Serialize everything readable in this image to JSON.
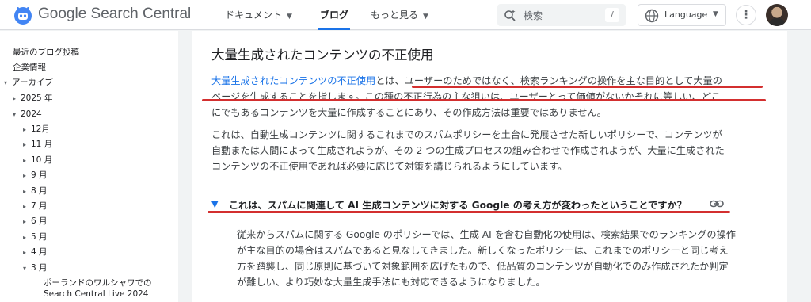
{
  "header": {
    "brand": "Google Search Central",
    "nav": [
      {
        "label": "ドキュメント",
        "has_dropdown": true
      },
      {
        "label": "ブログ",
        "active": true
      },
      {
        "label": "もっと見る",
        "has_dropdown": true
      }
    ],
    "search_placeholder": "検索",
    "search_shortcut": "/",
    "language_label": "Language",
    "more_label": "⋮",
    "accent_color": "#1a73e8"
  },
  "sidebar": {
    "items": [
      {
        "label": "最近のブログ投稿"
      },
      {
        "label": "企業情報"
      },
      {
        "label": "アーカイブ",
        "caret": "▾"
      },
      {
        "label": "2025 年",
        "caret": "▸"
      },
      {
        "label": "2024",
        "caret": "▾"
      },
      {
        "label": "12月",
        "caret": "▸"
      },
      {
        "label": "11 月",
        "caret": "▸"
      },
      {
        "label": "10 月",
        "caret": "▸"
      },
      {
        "label": "9 月",
        "caret": "▸"
      },
      {
        "label": "8 月",
        "caret": "▸"
      },
      {
        "label": "7 月",
        "caret": "▸"
      },
      {
        "label": "6 月",
        "caret": "▸"
      },
      {
        "label": "5 月",
        "caret": "▸"
      },
      {
        "label": "4 月",
        "caret": "▸"
      },
      {
        "label": "3 月",
        "caret": "▾"
      }
    ],
    "post_title_line1": "ポーランドのワルシャワでの",
    "post_title_line2": "Search Central Live 2024"
  },
  "article": {
    "heading": "大量生成されたコンテンツの不正使用",
    "intro_link": "大量生成されたコンテンツの不正使用",
    "intro_line1_rest": "とは、ユーザーのためではなく、検索ランキングの操作を主な目的として大量の",
    "intro_line2": "ページを生成することを指します。この種の不正行為の主な狙いは、ユーザーとって価値がないかそれに等しい、どこ",
    "intro_line3": "にでもあるコンテンツを大量に作成することにあり、その作成方法は重要ではありません。",
    "para2_line1": "これは、自動生成コンテンツに関するこれまでのスパムポリシーを土台に発展させた新しいポリシーで、コンテンツが",
    "para2_line2": "自動または人間によって生成されようが、その 2 つの生成プロセスの組み合わせで作成されようが、大量に生成された",
    "para2_line3": "コンテンツの不正使用であれば必要に応じて対策を講じられるようにしています。",
    "question": "これは、スパムに関連して AI 生成コンテンツに対する Google の考え方が変わったということですか？",
    "answer_line1": "従来からスパムに関する Google のポリシーでは、生成 AI を含む自動化の使用は、検索結果でのランキングの操作",
    "answer_line2": "が主な目的の場合はスパムであると見なしてきました。新しくなったポリシーは、これまでのポリシーと同じ考え",
    "answer_line3": "方を踏襲し、同じ原則に基づいて対象範囲を広げたもので、低品質のコンテンツが自動化でのみ作成されたか判定",
    "answer_line4": "が難しい、より巧妙な大量生成手法にも対応できるようになりました。",
    "highlight_color": "#d32f2f"
  }
}
